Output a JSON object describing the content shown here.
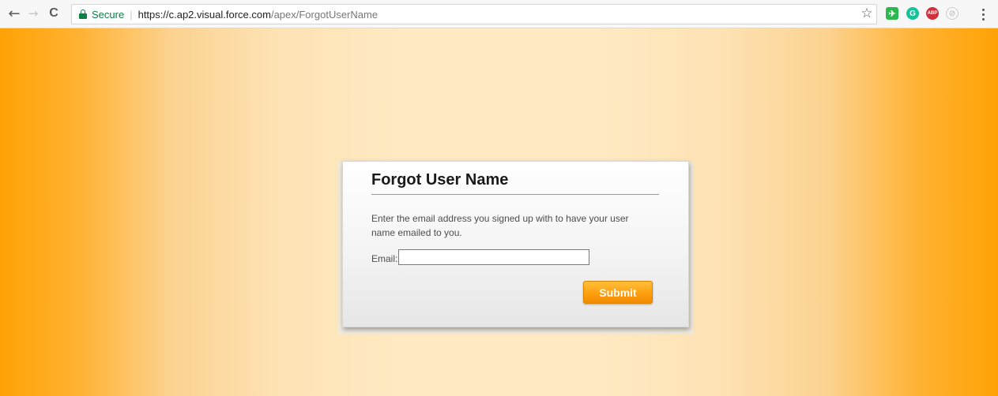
{
  "browser": {
    "secure_label": "Secure",
    "url_host": "https://c.ap2.visual.force.com",
    "url_path": "/apex/ForgotUserName",
    "nav_icons": {
      "back": "←",
      "forward": "→",
      "reload": "C"
    },
    "bookmark_icon": "☆",
    "extensions": [
      {
        "name": "evernote",
        "glyph": "✈"
      },
      {
        "name": "grammarly",
        "glyph": "G"
      },
      {
        "name": "adblock-plus",
        "glyph": "ABP"
      },
      {
        "name": "disabled-extension",
        "glyph": "⊘"
      }
    ]
  },
  "page": {
    "background_accent": "#ffa205",
    "form": {
      "title": "Forgot User Name",
      "instructions": "Enter the email address you signed up with to have your user name emailed to you.",
      "email_label": "Email:",
      "email_value": "",
      "submit_label": "Submit",
      "button_color": "#ff9f0f"
    }
  }
}
